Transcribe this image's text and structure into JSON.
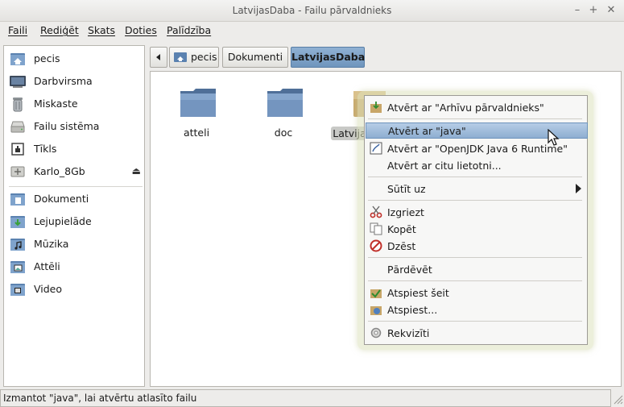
{
  "window": {
    "title": "LatvijasDaba - Failu pārvaldnieks"
  },
  "menubar": [
    "Faili",
    "Rediģēt",
    "Skats",
    "Doties",
    "Palīdzība"
  ],
  "sidebar": {
    "devices": [
      {
        "label": "pecis",
        "icon": "home-folder-icon"
      },
      {
        "label": "Darbvirsma",
        "icon": "desktop-icon"
      },
      {
        "label": "Miskaste",
        "icon": "trash-icon"
      },
      {
        "label": "Failu sistēma",
        "icon": "drive-icon"
      },
      {
        "label": "Tīkls",
        "icon": "network-icon"
      },
      {
        "label": "Karlo_8Gb",
        "icon": "usb-drive-icon"
      }
    ],
    "places": [
      {
        "label": "Dokumenti",
        "icon": "documents-folder-icon"
      },
      {
        "label": "Lejupielāde",
        "icon": "downloads-folder-icon"
      },
      {
        "label": "Mūzika",
        "icon": "music-folder-icon"
      },
      {
        "label": "Attēli",
        "icon": "pictures-folder-icon"
      },
      {
        "label": "Video",
        "icon": "video-folder-icon"
      }
    ]
  },
  "pathbar": [
    "pecis",
    "Dokumenti",
    "LatvijasDaba"
  ],
  "files": [
    {
      "name": "atteli"
    },
    {
      "name": "doc"
    },
    {
      "name": "Latvija"
    }
  ],
  "context_menu": {
    "items": [
      {
        "label": "Atvērt ar \"Arhīvu pārvaldnieks\"",
        "icon": "archive-manager-icon"
      },
      {
        "label": "Atvērt ar \"java\"",
        "icon": "",
        "highlighted": true
      },
      {
        "label": "Atvērt ar \"OpenJDK Java 6 Runtime\"",
        "icon": "java-runtime-icon"
      },
      {
        "label": "Atvērt ar citu lietotni...",
        "icon": ""
      },
      {
        "label": "Sūtīt uz",
        "icon": "",
        "submenu": true
      },
      {
        "label": "Izgriezt",
        "icon": "cut-icon"
      },
      {
        "label": "Kopēt",
        "icon": "copy-icon"
      },
      {
        "label": "Dzēst",
        "icon": "delete-icon"
      },
      {
        "label": "Pārdēvēt",
        "icon": ""
      },
      {
        "label": "Atspiest šeit",
        "icon": "extract-here-icon"
      },
      {
        "label": "Atspiest...",
        "icon": "extract-icon"
      },
      {
        "label": "Rekvizīti",
        "icon": "properties-icon"
      }
    ]
  },
  "statusbar": {
    "text": "Izmantot \"java\", lai atvērtu atlasīto failu"
  },
  "colors": {
    "selection": "#8eaed1",
    "folder": "#6b8bb3",
    "active_path": "#7a9ec6"
  }
}
